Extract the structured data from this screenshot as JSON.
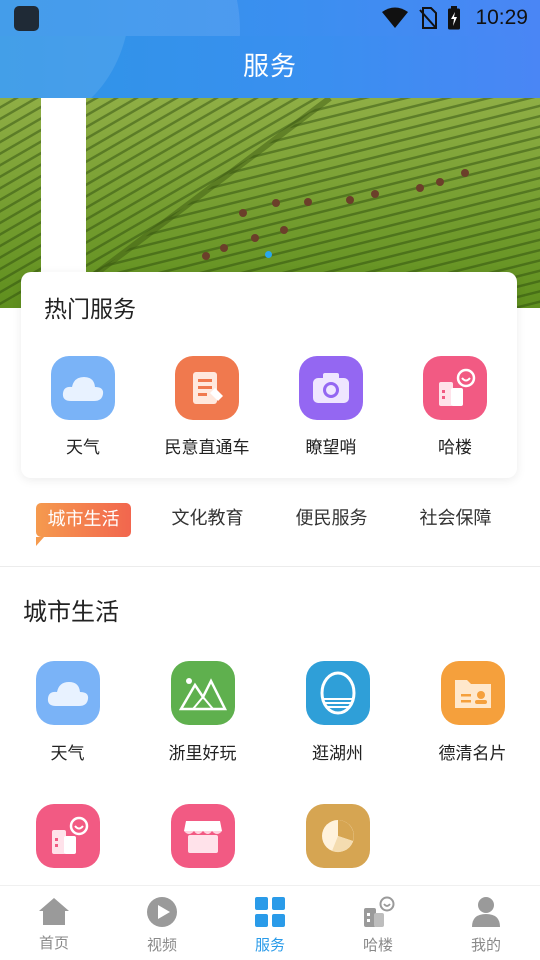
{
  "status_bar": {
    "time": "10:29",
    "icons": [
      "notification-icon",
      "wifi-icon",
      "no-sim-icon",
      "battery-charging-icon"
    ]
  },
  "header": {
    "title": "服务"
  },
  "banner": {
    "indicator_count": 1,
    "active_index": 0
  },
  "hot_services": {
    "title": "热门服务",
    "items": [
      {
        "label": "天气",
        "icon": "cloud-icon",
        "color": "#7ab3f7"
      },
      {
        "label": "民意直通车",
        "icon": "document-edit-icon",
        "color": "#f0794e"
      },
      {
        "label": "瞭望哨",
        "icon": "camera-icon",
        "color": "#9467f2"
      },
      {
        "label": "哈楼",
        "icon": "building-smile-icon",
        "color": "#f25a83"
      }
    ]
  },
  "tabs": {
    "active_index": 0,
    "items": [
      "城市生活",
      "文化教育",
      "便民服务",
      "社会保障"
    ],
    "active_color": "#f2664e"
  },
  "section": {
    "title": "城市生活",
    "rows": [
      [
        {
          "label": "天气",
          "icon": "cloud-icon",
          "color": "#7ab3f7"
        },
        {
          "label": "浙里好玩",
          "icon": "mountain-icon",
          "color": "#5fb04e"
        },
        {
          "label": "逛湖州",
          "icon": "city-logo-icon",
          "color": "#2f9fd8"
        },
        {
          "label": "德清名片",
          "icon": "business-card-icon",
          "color": "#f5a03c"
        }
      ],
      [
        {
          "label": "",
          "icon": "building-smile-icon",
          "color": "#f25a83"
        },
        {
          "label": "",
          "icon": "shop-icon",
          "color": "#f25a83"
        },
        {
          "label": "",
          "icon": "pie-chart-icon",
          "color": "#d6a552"
        }
      ]
    ]
  },
  "bottom_nav": {
    "active_index": 2,
    "active_color": "#2a9be9",
    "items": [
      {
        "label": "首页",
        "icon": "home-icon"
      },
      {
        "label": "视频",
        "icon": "play-circle-icon"
      },
      {
        "label": "服务",
        "icon": "grid-icon"
      },
      {
        "label": "哈楼",
        "icon": "building-smile-icon"
      },
      {
        "label": "我的",
        "icon": "user-icon"
      }
    ]
  }
}
